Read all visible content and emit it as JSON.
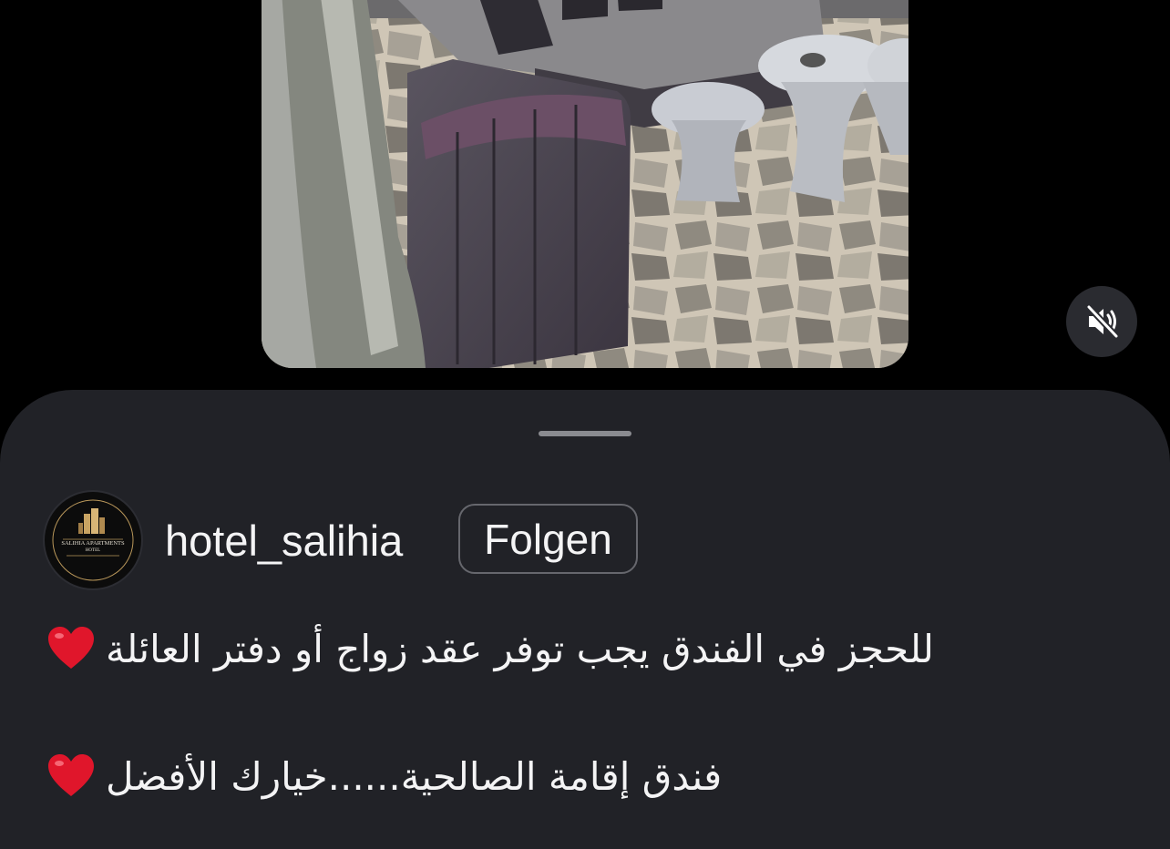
{
  "post": {
    "username": "hotel_salihia",
    "follow_label": "Folgen",
    "avatar_logo_text": "SALIHIA APARTMENTS HOTEL",
    "caption_lines": [
      "للحجز في الفندق يجب توفر عقد زواج أو دفتر العائلة",
      "فندق إقامة الصالحية......خيارك الأفضل"
    ],
    "caption_emoji": "heart-icon"
  },
  "media": {
    "sound_state": "muted",
    "mute_icon": "speaker-muted-icon"
  },
  "colors": {
    "sheet_bg": "#212227",
    "background": "#000000",
    "text": "#f4f4f5",
    "heart": "#e0162b",
    "follow_border": "#66676d"
  }
}
